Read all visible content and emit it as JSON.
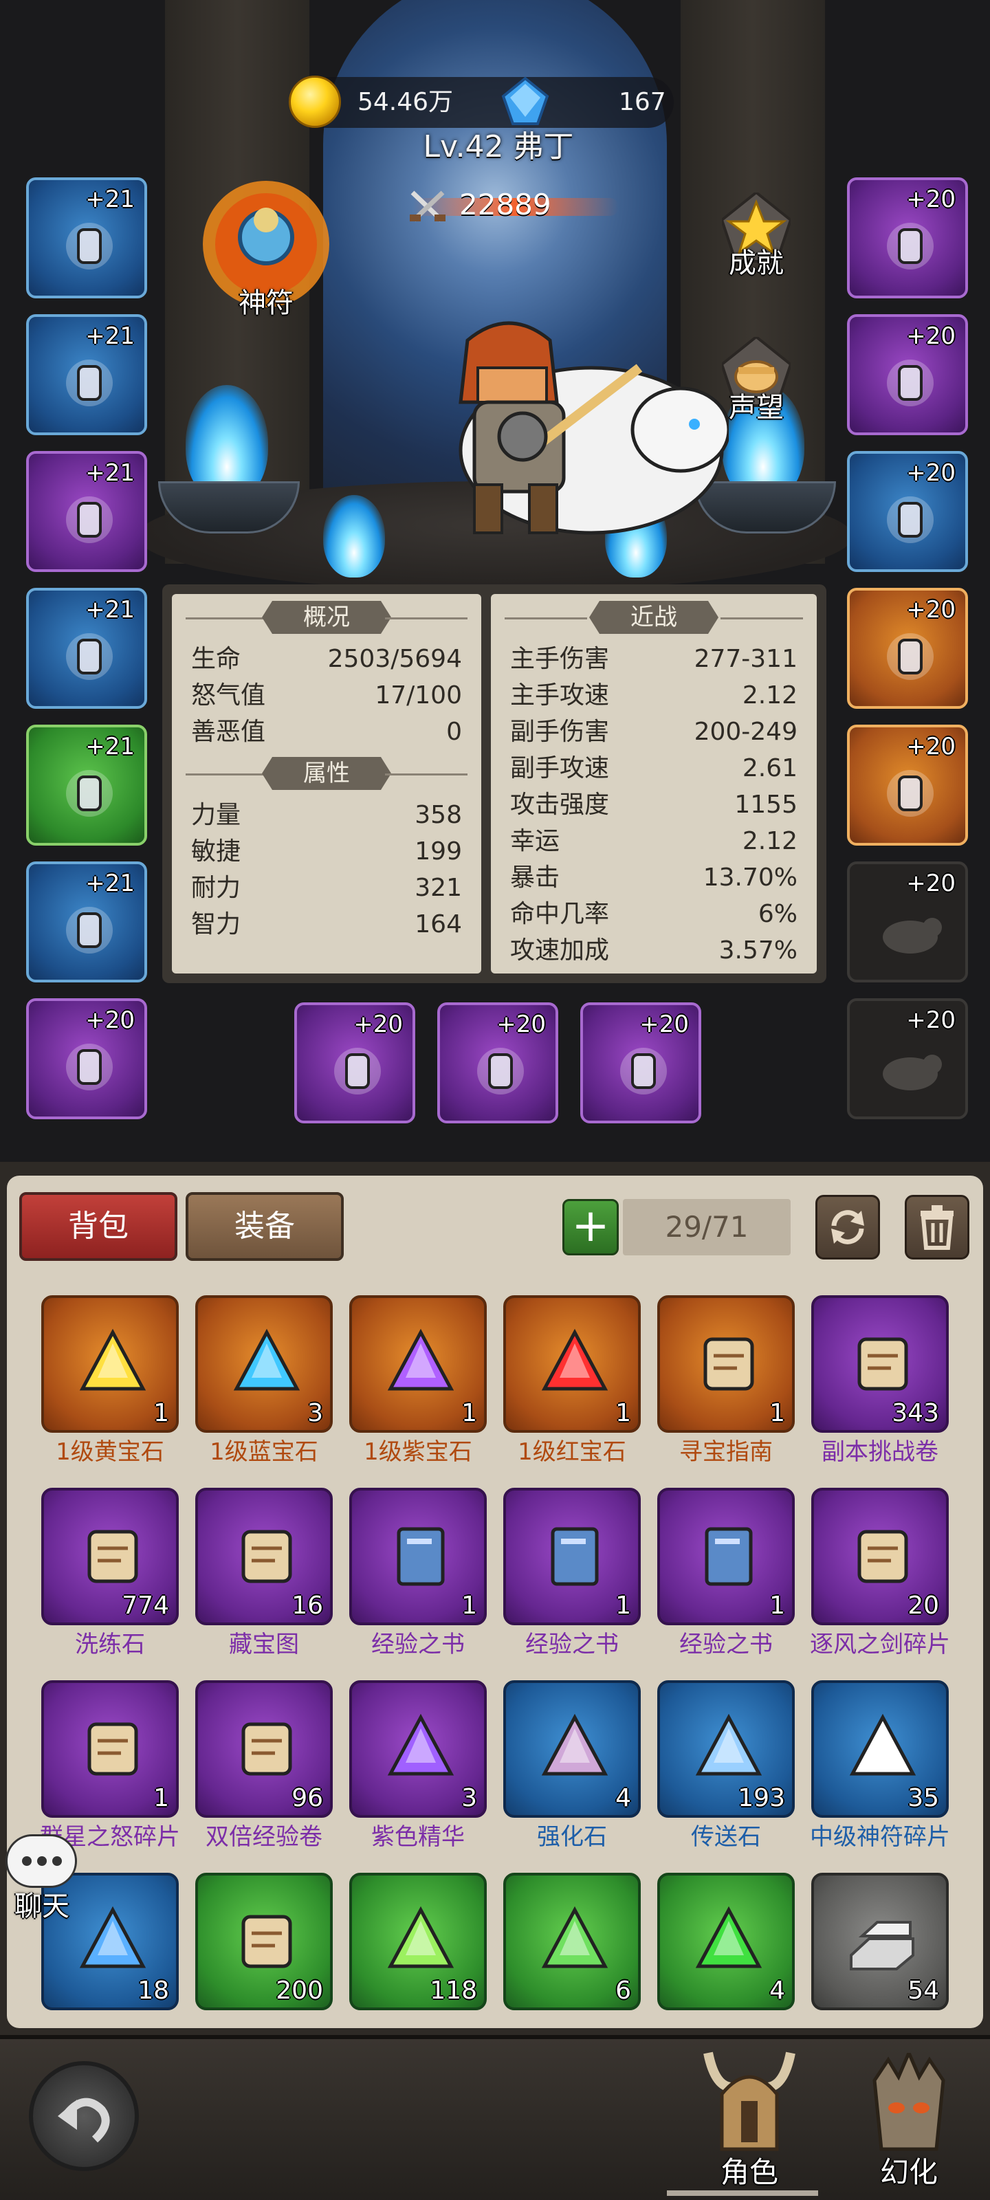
{
  "header": {
    "gold": "54.46万",
    "diamonds": "167",
    "level_name": "Lv.42 弗丁",
    "combat_power": "22889"
  },
  "side_buttons": {
    "talisman": "神符",
    "achievement": "成就",
    "reputation": "声望"
  },
  "left_slots": [
    {
      "level": "+21",
      "rarity": "blue",
      "icon": "helmet-icon"
    },
    {
      "level": "+21",
      "rarity": "blue",
      "icon": "necklace-icon"
    },
    {
      "level": "+21",
      "rarity": "purple",
      "icon": "shoulder-icon"
    },
    {
      "level": "+21",
      "rarity": "blue",
      "icon": "chest-armor-icon"
    },
    {
      "level": "+21",
      "rarity": "green",
      "icon": "cloak-icon"
    },
    {
      "level": "+21",
      "rarity": "blue",
      "icon": "bracer-icon"
    },
    {
      "level": "+20",
      "rarity": "purple",
      "icon": "bow-icon"
    }
  ],
  "right_slots": [
    {
      "level": "+20",
      "rarity": "purple",
      "icon": "belt-icon"
    },
    {
      "level": "+20",
      "rarity": "purple",
      "icon": "pants-icon"
    },
    {
      "level": "+20",
      "rarity": "blue",
      "icon": "boots-icon"
    },
    {
      "level": "+20",
      "rarity": "orange",
      "icon": "ring-icon"
    },
    {
      "level": "+20",
      "rarity": "orange",
      "icon": "ring-icon"
    },
    {
      "level": "+20",
      "rarity": "empty",
      "icon": "pet-silhouette-icon"
    },
    {
      "level": "+20",
      "rarity": "empty",
      "icon": "pet-silhouette-icon"
    }
  ],
  "weapon_slots": [
    {
      "level": "+20",
      "rarity": "purple",
      "icon": "sword-icon"
    },
    {
      "level": "+20",
      "rarity": "purple",
      "icon": "hammer-icon"
    },
    {
      "level": "+20",
      "rarity": "purple",
      "icon": "blade-icon"
    }
  ],
  "stats": {
    "overview_title": "概况",
    "overview": [
      {
        "label": "生命",
        "value": "2503/5694"
      },
      {
        "label": "怒气值",
        "value": "17/100"
      },
      {
        "label": "善恶值",
        "value": "0"
      }
    ],
    "attributes_title": "属性",
    "attributes": [
      {
        "label": "力量",
        "value": "358"
      },
      {
        "label": "敏捷",
        "value": "199"
      },
      {
        "label": "耐力",
        "value": "321"
      },
      {
        "label": "智力",
        "value": "164"
      }
    ],
    "melee_title": "近战",
    "melee": [
      {
        "label": "主手伤害",
        "value": "277-311"
      },
      {
        "label": "主手攻速",
        "value": "2.12"
      },
      {
        "label": "副手伤害",
        "value": "200-249"
      },
      {
        "label": "副手攻速",
        "value": "2.61"
      },
      {
        "label": "攻击强度",
        "value": "1155"
      },
      {
        "label": "幸运",
        "value": "2.12"
      },
      {
        "label": "暴击",
        "value": "13.70%"
      },
      {
        "label": "命中几率",
        "value": "6%"
      },
      {
        "label": "攻速加成",
        "value": "3.57%"
      }
    ]
  },
  "inventory": {
    "tab_bag": "背包",
    "tab_equip": "装备",
    "add_label": "+",
    "capacity": "29/71",
    "items": [
      {
        "name": "1级黄宝石",
        "count": "1",
        "rarity": "orange",
        "icon": "yellow-gem-icon",
        "name_color": "orange"
      },
      {
        "name": "1级蓝宝石",
        "count": "3",
        "rarity": "orange",
        "icon": "blue-gem-icon",
        "name_color": "orange"
      },
      {
        "name": "1级紫宝石",
        "count": "1",
        "rarity": "orange",
        "icon": "purple-gem-icon",
        "name_color": "orange"
      },
      {
        "name": "1级红宝石",
        "count": "1",
        "rarity": "orange",
        "icon": "red-gem-icon",
        "name_color": "orange"
      },
      {
        "name": "寻宝指南",
        "count": "1",
        "rarity": "orange",
        "icon": "treasure-map-icon",
        "name_color": "orange"
      },
      {
        "name": "副本挑战卷",
        "count": "343",
        "rarity": "purple",
        "icon": "scroll-icon",
        "name_color": "purple"
      },
      {
        "name": "洗练石",
        "count": "774",
        "rarity": "purple",
        "icon": "rune-stone-icon",
        "name_color": "purple"
      },
      {
        "name": "藏宝图",
        "count": "16",
        "rarity": "purple",
        "icon": "map-scroll-icon",
        "name_color": "purple"
      },
      {
        "name": "经验之书",
        "count": "1",
        "rarity": "purple",
        "icon": "book-icon",
        "name_color": "purple"
      },
      {
        "name": "经验之书",
        "count": "1",
        "rarity": "purple",
        "icon": "book-icon",
        "name_color": "purple"
      },
      {
        "name": "经验之书",
        "count": "1",
        "rarity": "purple",
        "icon": "book-icon",
        "name_color": "purple"
      },
      {
        "name": "逐风之剑碎片",
        "count": "20",
        "rarity": "purple",
        "icon": "sword-shard-icon",
        "name_color": "purple"
      },
      {
        "name": "群星之怒碎片",
        "count": "1",
        "rarity": "purple",
        "icon": "bow-shard-icon",
        "name_color": "purple"
      },
      {
        "name": "双倍经验卷",
        "count": "96",
        "rarity": "purple",
        "icon": "exp-scroll-icon",
        "name_color": "purple"
      },
      {
        "name": "紫色精华",
        "count": "3",
        "rarity": "purple",
        "icon": "purple-essence-icon",
        "name_color": "purple"
      },
      {
        "name": "强化石",
        "count": "4",
        "rarity": "blue",
        "icon": "enhance-stone-icon",
        "name_color": "blue"
      },
      {
        "name": "传送石",
        "count": "193",
        "rarity": "blue",
        "icon": "teleport-stone-icon",
        "name_color": "blue"
      },
      {
        "name": "中级神符碎片",
        "count": "35",
        "rarity": "blue",
        "icon": "talisman-shard-icon",
        "name_color": "blue"
      },
      {
        "name": "",
        "count": "18",
        "rarity": "blue",
        "icon": "blue-crystal-icon",
        "name_color": "blue"
      },
      {
        "name": "",
        "count": "200",
        "rarity": "green",
        "icon": "potion-cup-icon",
        "name_color": "blue"
      },
      {
        "name": "",
        "count": "118",
        "rarity": "green",
        "icon": "green-gem-icon",
        "name_color": "blue"
      },
      {
        "name": "",
        "count": "6",
        "rarity": "green",
        "icon": "green-orb-icon",
        "name_color": "blue"
      },
      {
        "name": "",
        "count": "4",
        "rarity": "green",
        "icon": "emerald-icon",
        "name_color": "blue"
      },
      {
        "name": "",
        "count": "54",
        "rarity": "gray",
        "icon": "silver-ingot-icon",
        "name_color": "blue"
      }
    ]
  },
  "chat": {
    "label": "聊天"
  },
  "bottom_nav": {
    "character": "角色",
    "transform": "幻化"
  }
}
